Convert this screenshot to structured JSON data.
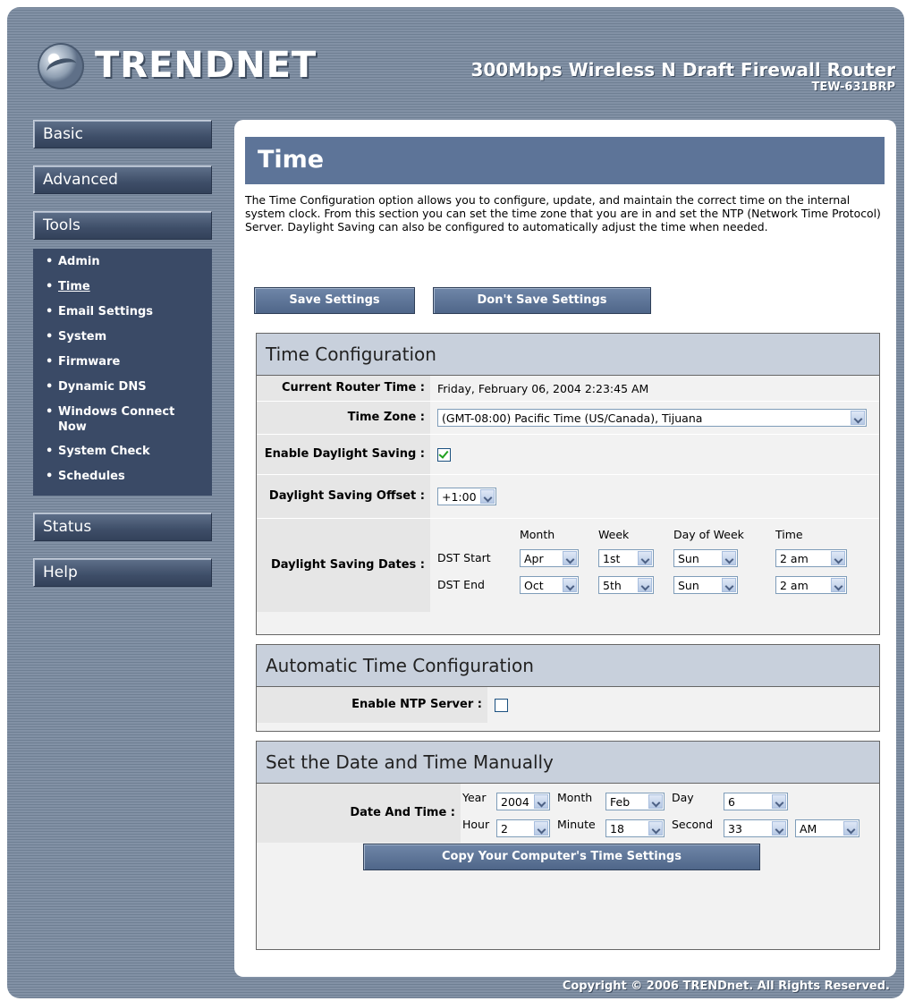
{
  "brand": {
    "logo_text": "TRENDNET",
    "product_name": "300Mbps Wireless N Draft Firewall Router",
    "model": "TEW-631BRP"
  },
  "nav": {
    "basic": "Basic",
    "advanced": "Advanced",
    "tools": "Tools",
    "tools_items": [
      "Admin",
      "Time",
      "Email Settings",
      "System",
      "Firmware",
      "Dynamic DNS",
      "Windows Connect Now",
      "System Check",
      "Schedules"
    ],
    "status": "Status",
    "help": "Help"
  },
  "page": {
    "title": "Time",
    "intro": "The Time Configuration option allows you to configure, update, and maintain the correct time on the internal system clock. From this section you can set the time zone that you are in and set the NTP (Network Time Protocol) Server. Daylight Saving can also be configured to automatically adjust the time when needed.",
    "save_label": "Save Settings",
    "dont_save_label": "Don't Save Settings"
  },
  "time_config": {
    "heading": "Time Configuration",
    "current_time_label": "Current Router Time :",
    "current_time_value": "Friday, February 06, 2004 2:23:45 AM",
    "time_zone_label": "Time Zone :",
    "time_zone_value": "(GMT-08:00) Pacific Time (US/Canada), Tijuana",
    "enable_dst_label": "Enable Daylight Saving :",
    "enable_dst_checked": true,
    "dst_offset_label": "Daylight Saving Offset :",
    "dst_offset_value": "+1:00",
    "dst_dates_label": "Daylight Saving Dates :",
    "col_month": "Month",
    "col_week": "Week",
    "col_dow": "Day of Week",
    "col_time": "Time",
    "dst_start_label": "DST Start",
    "dst_end_label": "DST End",
    "dst_start": {
      "month": "Apr",
      "week": "1st",
      "dow": "Sun",
      "time": "2 am"
    },
    "dst_end": {
      "month": "Oct",
      "week": "5th",
      "dow": "Sun",
      "time": "2 am"
    }
  },
  "auto_time": {
    "heading": "Automatic Time Configuration",
    "ntp_label": "Enable NTP Server :",
    "ntp_checked": false
  },
  "manual": {
    "heading": "Set the Date and Time Manually",
    "label": "Date And Time :",
    "year_label": "Year",
    "year": "2004",
    "month_label": "Month",
    "month": "Feb",
    "day_label": "Day",
    "day": "6",
    "hour_label": "Hour",
    "hour": "2",
    "minute_label": "Minute",
    "minute": "18",
    "second_label": "Second",
    "second": "33",
    "ampm": "AM",
    "copy_label": "Copy Your Computer's Time Settings"
  },
  "footer": {
    "copyright": "Copyright © 2006 TRENDnet. All Rights Reserved."
  }
}
